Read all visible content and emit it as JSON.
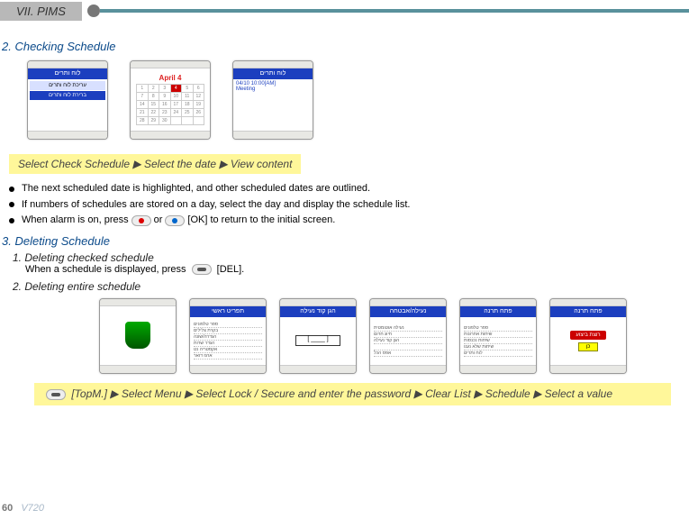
{
  "chapter": "VII.  PIMS",
  "sec2": {
    "title": "2. Checking Schedule",
    "phones": {
      "p1_header": "לוח ותרים",
      "p1_b1": "עריכת לוח ותרים",
      "p1_b2": "ברירת לוח ותרים",
      "p2_title": "April 4",
      "p3_time": "04/10 10:00[AM]",
      "p3_text": "Meeting"
    },
    "instruction": "Select Check Schedule ▶ Select the date ▶ View content",
    "bullets": {
      "b1": "The next scheduled date is highlighted, and other scheduled dates are outlined.",
      "b2": "If numbers of schedules are stored on a day, select the day and display the schedule list.",
      "b3a": "When alarm is on, press",
      "b3b": "or",
      "b3c": "[OK] to return to the initial screen."
    }
  },
  "sec3": {
    "title": "3. Deleting Schedule",
    "item1": {
      "head": "1. Deleting checked schedule",
      "desc_a": "When a schedule is displayed, press",
      "desc_b": "[DEL]."
    },
    "item2": {
      "head": "2. Deleting entire schedule"
    },
    "phones": {
      "h2": "תפריט ראשי",
      "h3": "הגן קוד נעילה",
      "h4": "נעילה/אבטחה",
      "h5": "פתח תרנה",
      "h6": "פתח תרנה",
      "confirm": "רוצת ביצוע",
      "yes": "כן"
    },
    "instruction": "[TopM.] ▶ Select Menu ▶ Select Lock / Secure and enter the password  ▶ Clear List ▶ Schedule ▶ Select a value"
  },
  "footer": {
    "page": "60",
    "model": "V720"
  }
}
